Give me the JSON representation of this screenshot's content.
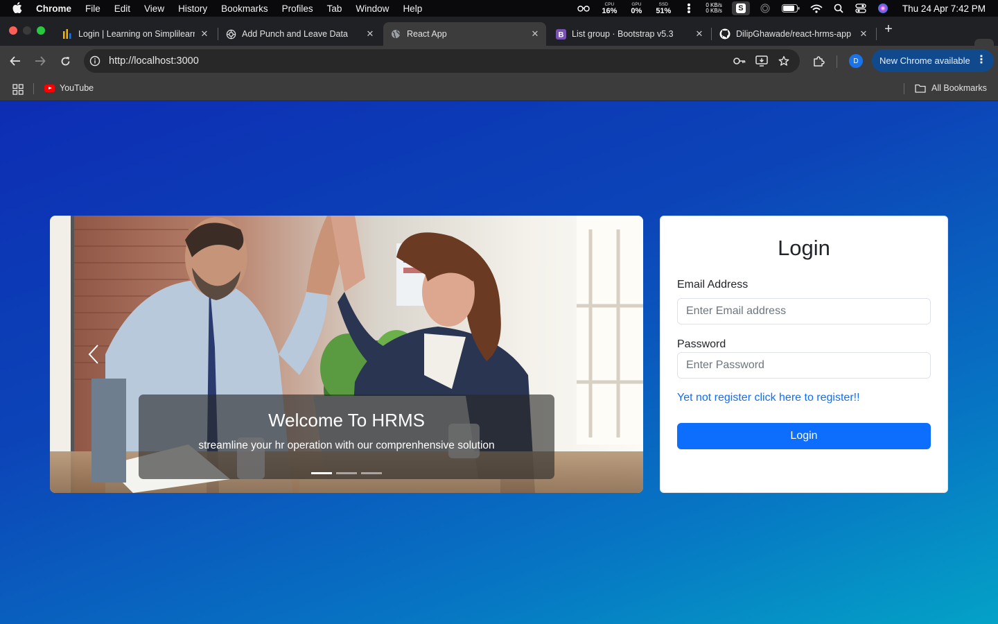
{
  "menubar": {
    "app": "Chrome",
    "items": [
      "File",
      "Edit",
      "View",
      "History",
      "Bookmarks",
      "Profiles",
      "Tab",
      "Window",
      "Help"
    ],
    "stats": [
      {
        "label": "CPU",
        "value": "16%"
      },
      {
        "label": "GPU",
        "value": "0%"
      },
      {
        "label": "SSD",
        "value": "51%"
      }
    ],
    "net_up": "0 KB/s",
    "net_down": "0 KB/s",
    "badge": "S",
    "clock": "Thu 24 Apr  7:42 PM"
  },
  "tabs": [
    {
      "title": "Login | Learning on Simplilearn",
      "icon": "simplilearn-icon"
    },
    {
      "title": "Add Punch and Leave Data",
      "icon": "openai-icon"
    },
    {
      "title": "React App",
      "icon": "globe-icon",
      "active": true
    },
    {
      "title": "List group · Bootstrap v5.3",
      "icon": "bootstrap-icon"
    },
    {
      "title": "DilipGhawade/react-hrms-app",
      "icon": "github-icon"
    }
  ],
  "toolbar": {
    "url": "http://localhost:3000",
    "profile_initial": "D",
    "update_label": "New Chrome available"
  },
  "bookmarks": {
    "items": [
      "YouTube"
    ],
    "all_label": "All Bookmarks"
  },
  "carousel": {
    "caption_title": "Welcome To HRMS",
    "caption_text": "streamline your hr operation with our comprenhensive solution",
    "slides": 3,
    "active_slide": 1
  },
  "login": {
    "title": "Login",
    "email_label": "Email Address",
    "email_placeholder": "Enter Email address",
    "password_label": "Password",
    "password_placeholder": "Enter Password",
    "register_link": "Yet not register click here to register!!",
    "submit_label": "Login"
  },
  "colors": {
    "primary": "#0d6efd",
    "page_gradient_start": "#0d2db3",
    "page_gradient_end": "#04a2c7"
  }
}
